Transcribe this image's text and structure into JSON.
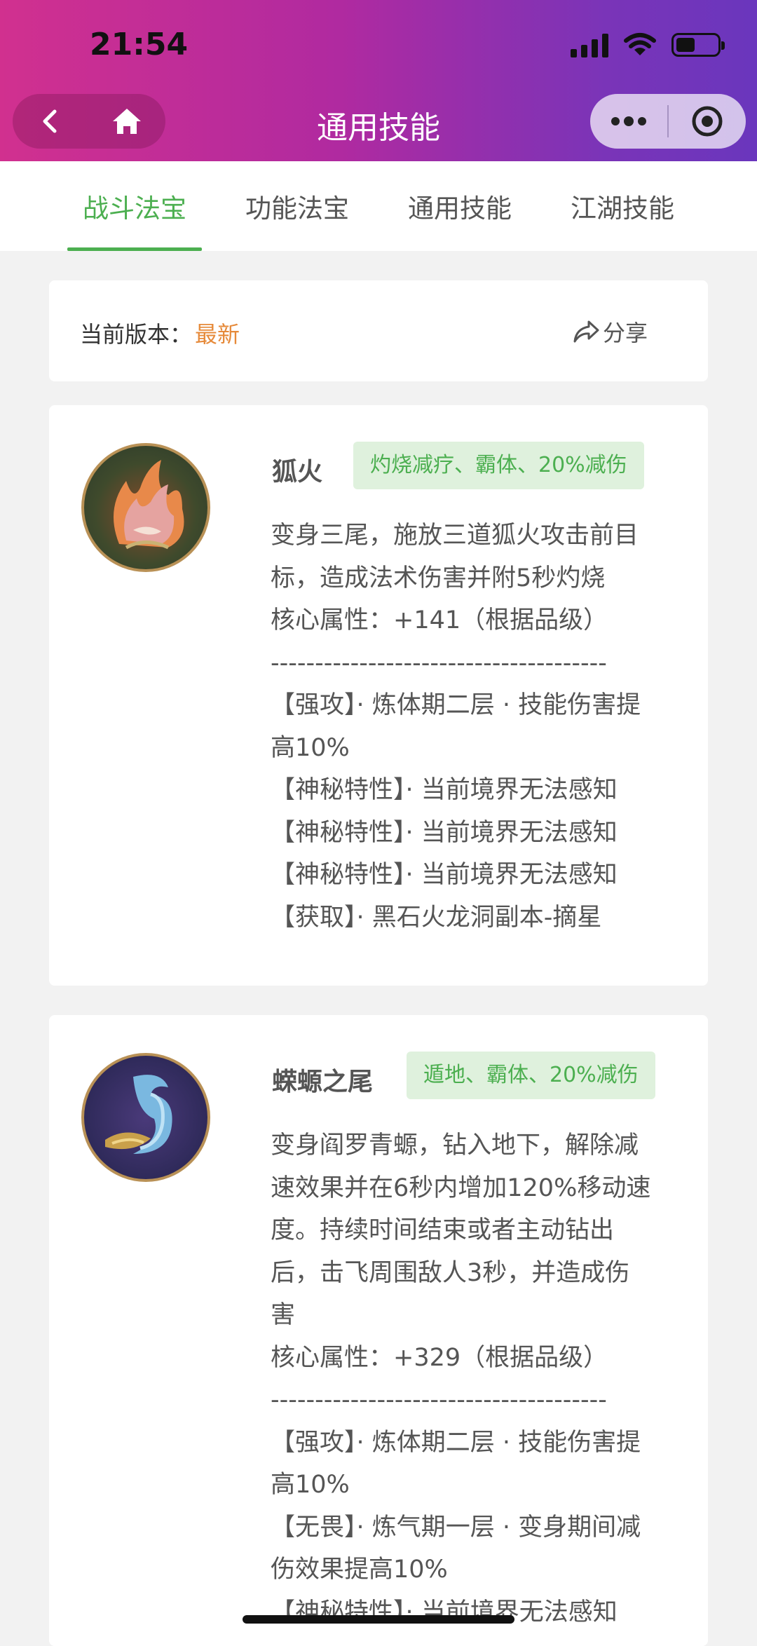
{
  "status_bar": {
    "time": "21:54"
  },
  "nav": {
    "title": "通用技能"
  },
  "tabs": [
    {
      "label": "战斗法宝",
      "active": true
    },
    {
      "label": "功能法宝",
      "active": false
    },
    {
      "label": "通用技能",
      "active": false
    },
    {
      "label": "江湖技能",
      "active": false
    }
  ],
  "version": {
    "label": "当前版本：",
    "value": "最新",
    "share_label": "分享"
  },
  "skills": [
    {
      "name": "狐火",
      "tag": "灼烧减疗、霸体、20%减伤",
      "lines": [
        "变身三尾，施放三道狐火攻击前目",
        "标，造成法术伤害并附5秒灼烧",
        "核心属性：+141（根据品级）",
        "--------------------------------------",
        "【强攻】· 炼体期二层 · 技能伤害提",
        "高10%",
        "【神秘特性】· 当前境界无法感知",
        "【神秘特性】· 当前境界无法感知",
        "【神秘特性】· 当前境界无法感知",
        "【获取】· 黑石火龙洞副本-摘星"
      ],
      "icon": "fox-fire-icon"
    },
    {
      "name": "蝾螈之尾",
      "tag": "遁地、霸体、20%减伤",
      "lines": [
        "变身阎罗青螈，钻入地下，解除减",
        "速效果并在6秒内增加120%移动速",
        "度。持续时间结束或者主动钻出",
        "后，击飞周围敌人3秒，并造成伤",
        "害",
        "核心属性：+329（根据品级）",
        "--------------------------------------",
        "【强攻】· 炼体期二层 · 技能伤害提",
        "高10%",
        "【无畏】· 炼气期一层 · 变身期间减",
        "伤效果提高10%",
        "【神秘特性】· 当前境界无法感知"
      ],
      "icon": "salamander-tail-icon"
    }
  ],
  "colors": {
    "accent_green": "#4caf50",
    "tag_bg": "#dff1dd",
    "version_orange": "#e68a3a"
  }
}
